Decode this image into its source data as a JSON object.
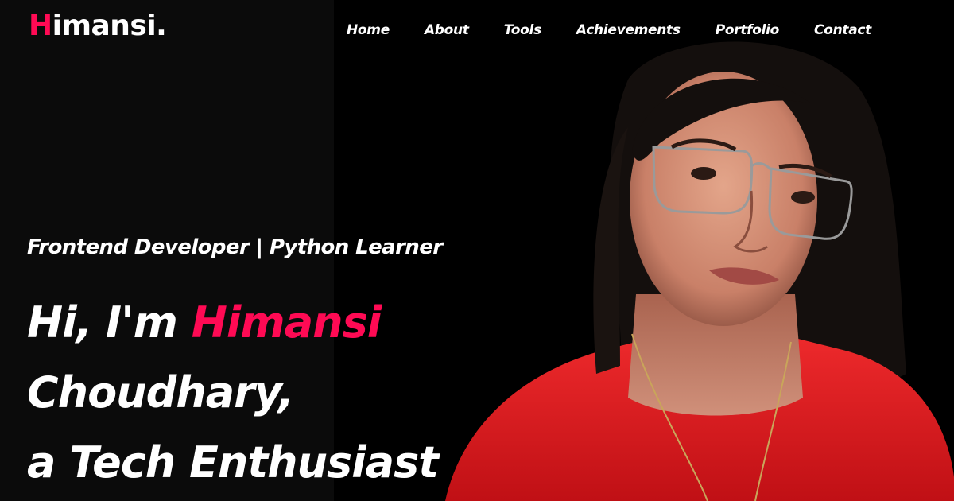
{
  "logo": {
    "initial": "H",
    "rest": "imansi."
  },
  "nav": {
    "items": [
      "Home",
      "About",
      "Tools",
      "Achievements",
      "Portfolio",
      "Contact"
    ]
  },
  "hero": {
    "subtitle": "Frontend Developer | Python Learner",
    "greeting": "Hi, I'm ",
    "first_name": "Himansi",
    "last_name": "Choudhary,",
    "tagline": "a Tech Enthusiast"
  },
  "colors": {
    "accent": "#ff0a54",
    "background": "#000000",
    "text": "#ffffff",
    "shirt": "#e0161e"
  }
}
